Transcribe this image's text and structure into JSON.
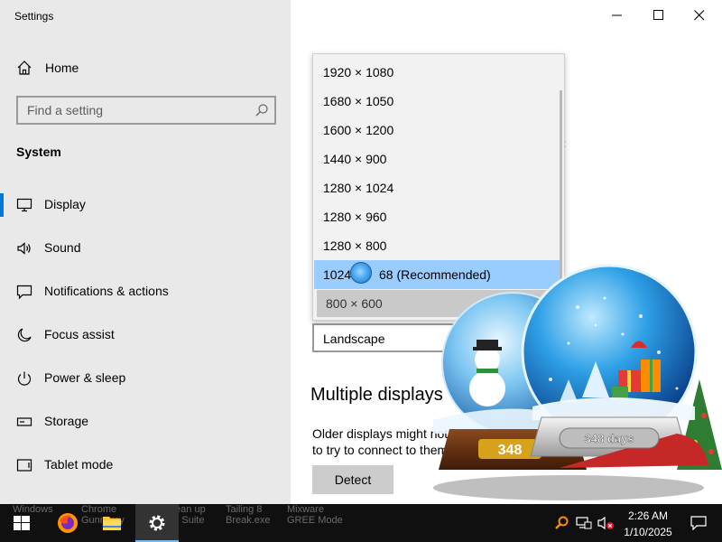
{
  "window": {
    "title": "Settings"
  },
  "sidebar": {
    "home_label": "Home",
    "search_placeholder": "Find a setting",
    "section_title": "System",
    "items": [
      {
        "label": "Display",
        "icon": "monitor-icon",
        "active": true
      },
      {
        "label": "Sound",
        "icon": "speaker-icon"
      },
      {
        "label": "Notifications & actions",
        "icon": "notification-icon"
      },
      {
        "label": "Focus assist",
        "icon": "moon-icon"
      },
      {
        "label": "Power & sleep",
        "icon": "power-icon"
      },
      {
        "label": "Storage",
        "icon": "storage-icon"
      },
      {
        "label": "Tablet mode",
        "icon": "tablet-icon"
      }
    ]
  },
  "resolution_dropdown": {
    "options": [
      "1920 × 1080",
      "1680 × 1050",
      "1600 × 1200",
      "1440 × 900",
      "1280 × 1024",
      "1280 × 960",
      "1280 × 800",
      "1024 × 768 (Recommended)",
      "800 × 600"
    ],
    "highlighted_label": "1024 × 768 (Recommended)",
    "highlighted_visible_text_left": "1024",
    "highlighted_visible_text_right": "68 (Recommended)",
    "current": "800 × 600"
  },
  "orientation": {
    "value": "Landscape"
  },
  "multiple_displays": {
    "heading": "Multiple displays",
    "description_line1": "Older displays might not a",
    "description_line2": "to try to connect to them",
    "detect_label": "Detect"
  },
  "decoration": {
    "globe_back_badge": "348",
    "globe_front_badge": "348 days"
  },
  "taskbar": {
    "ghost_texts": [
      "Windows",
      "Chrome",
      "Free Clean up",
      "Tailing 8",
      "Mixware"
    ],
    "ghost_texts_line2": [
      "",
      "Gunnarsy",
      "Registry Suite",
      "Break.exe",
      "GREE Mode"
    ],
    "apps": [
      {
        "name": "start",
        "icon": "windows-icon"
      },
      {
        "name": "firefox",
        "icon": "firefox-icon"
      },
      {
        "name": "file-explorer",
        "icon": "folder-icon"
      },
      {
        "name": "settings",
        "icon": "gear-icon",
        "active": true
      }
    ],
    "tray_icons": [
      "search-tray-icon",
      "network-icon",
      "volume-muted-icon"
    ],
    "clock_time": "2:26 AM",
    "clock_date": "1/10/2025",
    "notification_icon": "action-center-icon"
  },
  "colors": {
    "sidebar_bg": "#e9e9e9",
    "accent": "#0078d7",
    "selection": "#99ccff",
    "taskbar_bg": "#101010"
  }
}
